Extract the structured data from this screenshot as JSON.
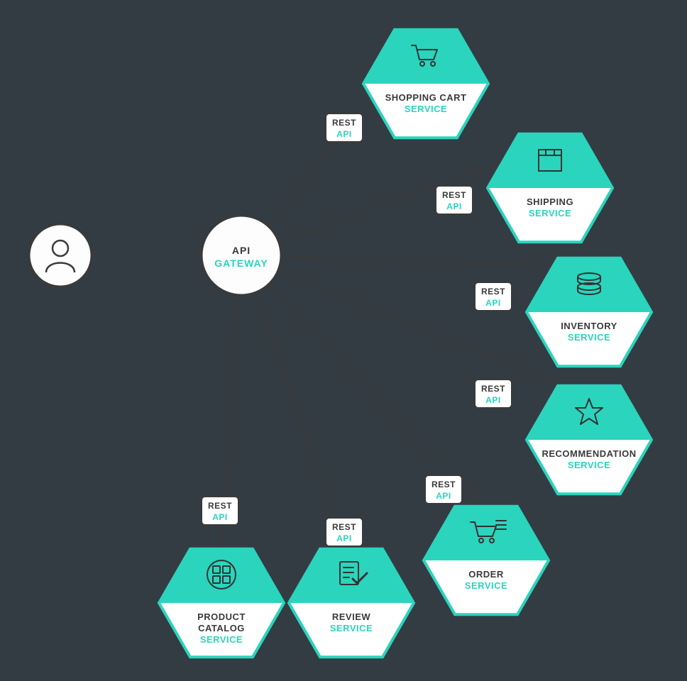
{
  "accent": "#2ad4bd",
  "user_node": {
    "type": "user"
  },
  "gateway": {
    "line1": "API",
    "line2": "GATEWAY"
  },
  "rest_box": {
    "line1": "REST",
    "line2": "API"
  },
  "services": [
    {
      "id": "shopping-cart",
      "icon": "cart",
      "lines": [
        "SHOPPING CART"
      ],
      "sub": "SERVICE"
    },
    {
      "id": "shipping",
      "icon": "box",
      "lines": [
        "SHIPPING"
      ],
      "sub": "SERVICE"
    },
    {
      "id": "inventory",
      "icon": "coins",
      "lines": [
        "INVENTORY"
      ],
      "sub": "SERVICE"
    },
    {
      "id": "recommendation",
      "icon": "star",
      "lines": [
        "RECOMMENDATION"
      ],
      "sub": "SERVICE"
    },
    {
      "id": "order",
      "icon": "list-cart",
      "lines": [
        "ORDER"
      ],
      "sub": "SERVICE"
    },
    {
      "id": "review",
      "icon": "check-doc",
      "lines": [
        "REVIEW"
      ],
      "sub": "SERVICE"
    },
    {
      "id": "product-catalog",
      "icon": "grid",
      "lines": [
        "PRODUCT",
        "CATALOG"
      ],
      "sub": "SERVICE"
    }
  ]
}
